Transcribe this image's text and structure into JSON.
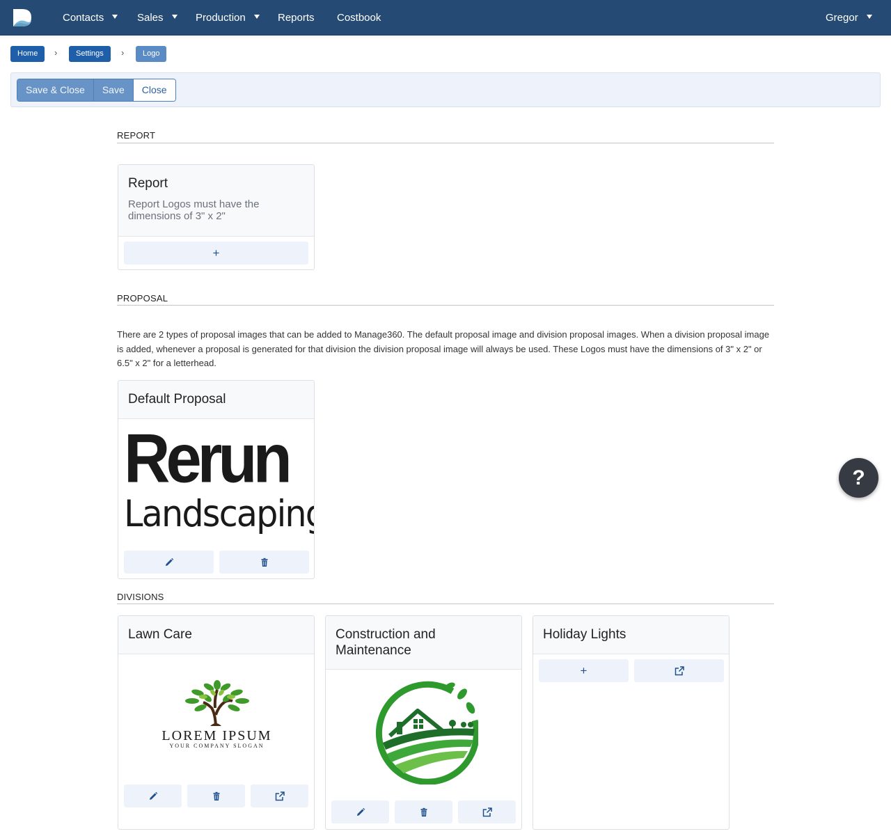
{
  "nav": {
    "items": [
      {
        "label": "Contacts",
        "dropdown": true
      },
      {
        "label": "Sales",
        "dropdown": true
      },
      {
        "label": "Production",
        "dropdown": true
      },
      {
        "label": "Reports",
        "dropdown": false
      },
      {
        "label": "Costbook",
        "dropdown": false
      }
    ],
    "user": "Gregor"
  },
  "breadcrumb": [
    "Home",
    "Settings",
    "Logo"
  ],
  "toolbar": {
    "save_close": "Save & Close",
    "save": "Save",
    "close": "Close"
  },
  "report_section": {
    "heading": "REPORT",
    "card": {
      "title": "Report",
      "subtitle": "Report Logos must have the dimensions of 3\" x 2\"",
      "add_label": "+"
    }
  },
  "proposal_section": {
    "heading": "PROPOSAL",
    "description": "There are 2 types of proposal images that can be added to Manage360. The default proposal image and division proposal images. When a division proposal image is added, whenever a proposal is generated for that division the division proposal image will always be used.  These Logos must have the dimensions of 3\" x 2\" or 6.5\" x 2\" for a letterhead.",
    "default_card": {
      "title": "Default Proposal",
      "logo_line1": "Rerun",
      "logo_line2": "Landscaping"
    }
  },
  "divisions_section": {
    "heading": "DIVISIONS",
    "cards": [
      {
        "title": "Lawn Care",
        "logo_text": "LOREM IPSUM",
        "logo_slogan": "YOUR COMPANY SLOGAN"
      },
      {
        "title": "Construction and Maintenance"
      },
      {
        "title": "Holiday Lights",
        "add_label": "+"
      }
    ]
  },
  "help": {
    "label": "?"
  },
  "colors": {
    "navbar": "#254a73",
    "accent": "#1f5ea8",
    "button_bg": "#eef3fb"
  }
}
